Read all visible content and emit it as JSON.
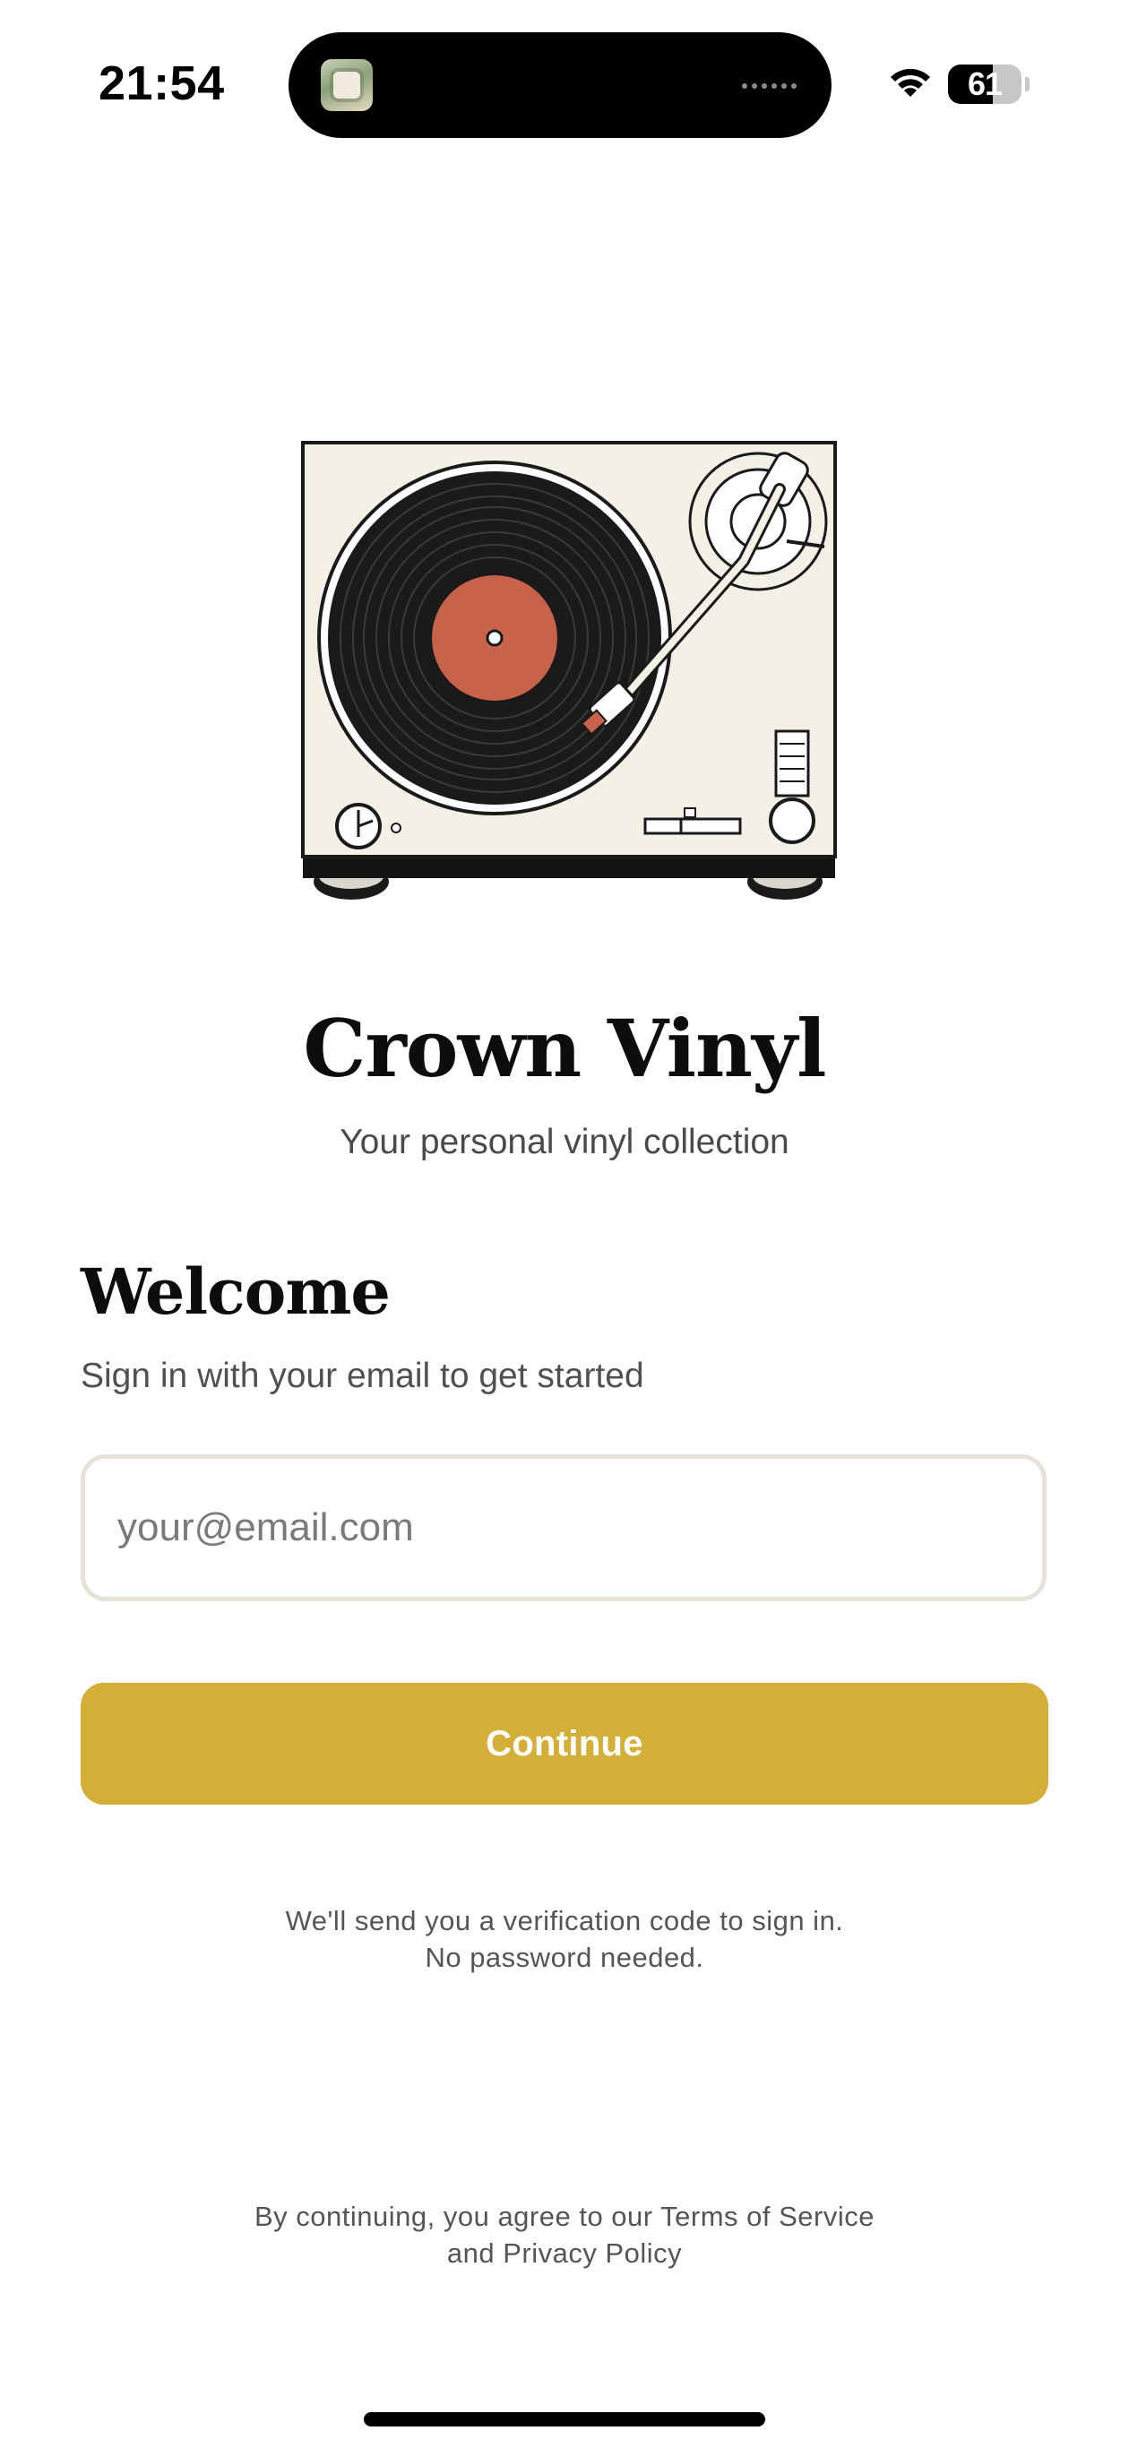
{
  "status_bar": {
    "time": "21:54",
    "battery_percent": "61",
    "battery_level": 0.61,
    "wifi_icon": "wifi-icon",
    "island_app_icon": "app-icon"
  },
  "brand": {
    "title": "Crown Vinyl",
    "subtitle": "Your personal vinyl collection",
    "illustration_icon": "turntable-illustration",
    "accent_color": "#d4af37",
    "label_color": "#c8624a"
  },
  "welcome": {
    "heading": "Welcome",
    "subheading": "Sign in with your email to get started"
  },
  "form": {
    "email_placeholder": "your@email.com",
    "email_value": "",
    "continue_label": "Continue"
  },
  "hint": {
    "line1": "We'll send you a verification code to sign in.",
    "line2": "No password needed."
  },
  "legal": {
    "line1": "By continuing, you agree to our Terms of Service",
    "line2": "and Privacy Policy"
  }
}
